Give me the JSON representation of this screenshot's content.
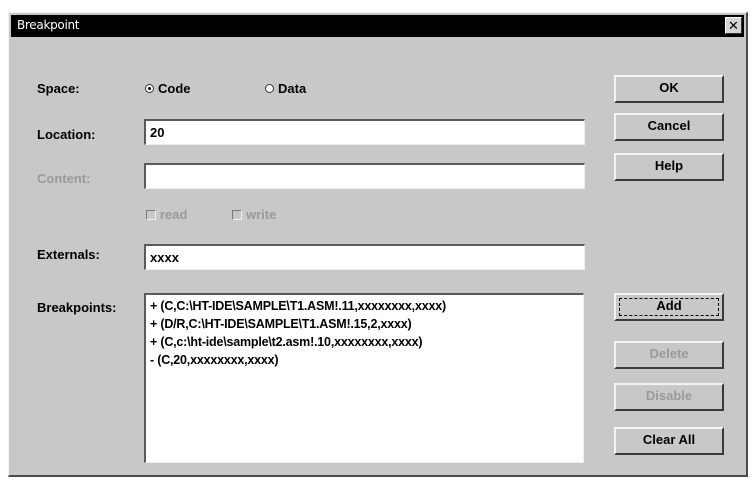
{
  "window": {
    "title": "Breakpoint",
    "close_glyph": "✕"
  },
  "space": {
    "label": "Space:",
    "code": "Code",
    "data": "Data",
    "selected": "Code"
  },
  "location": {
    "label": "Location:",
    "value": "20"
  },
  "content": {
    "label": "Content:",
    "value": ""
  },
  "access": {
    "read": "read",
    "write": "write"
  },
  "externals": {
    "label": "Externals:",
    "value": "xxxx"
  },
  "breakpoints": {
    "label": "Breakpoints:",
    "items": [
      "+ (C,C:\\HT-IDE\\SAMPLE\\T1.ASM!.11,xxxxxxxx,xxxx)",
      "+ (D/R,C:\\HT-IDE\\SAMPLE\\T1.ASM!.15,2,xxxx)",
      "+ (C,c:\\ht-ide\\sample\\t2.asm!.10,xxxxxxxx,xxxx)",
      "- (C,20,xxxxxxxx,xxxx)"
    ]
  },
  "buttons": {
    "ok": "OK",
    "cancel": "Cancel",
    "help": "Help",
    "add": "Add",
    "delete": "Delete",
    "disable": "Disable",
    "clear_all": "Clear All"
  }
}
